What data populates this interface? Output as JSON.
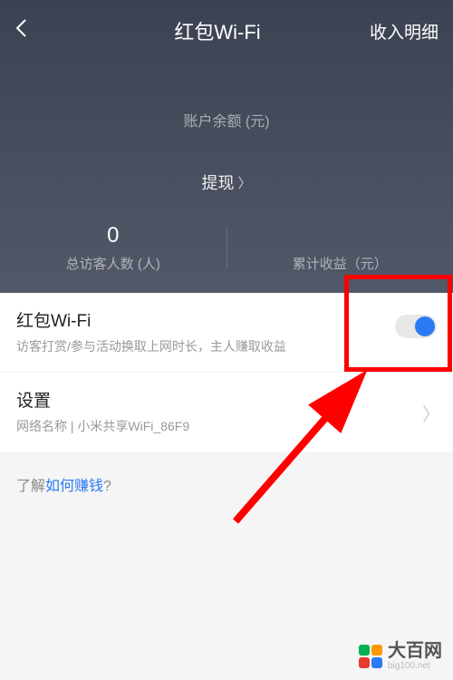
{
  "header": {
    "title": "红包Wi-Fi",
    "details_label": "收入明细"
  },
  "balance": {
    "label": "账户余额 (元)"
  },
  "withdraw": {
    "label": "提现"
  },
  "stats": {
    "visitors": {
      "value": "0",
      "label": "总访客人数 (人)"
    },
    "earnings": {
      "label": "累计收益（元）"
    }
  },
  "hongbao": {
    "title": "红包Wi-Fi",
    "subtitle": "访客打赏/参与活动换取上网时长，主人赚取收益",
    "toggle_on": true
  },
  "settings": {
    "title": "设置",
    "network_prefix": "网络名称 |  ",
    "network_name": "小米共享WiFi_86F9"
  },
  "learn": {
    "prefix": "了解",
    "link": "如何赚钱",
    "suffix": "?"
  },
  "watermark": {
    "text": "大百网",
    "sub": "big100.net",
    "colors": {
      "tl": "#00b14f",
      "tr": "#ff9900",
      "bl": "#e43b2c",
      "br": "#2a7af5"
    }
  }
}
